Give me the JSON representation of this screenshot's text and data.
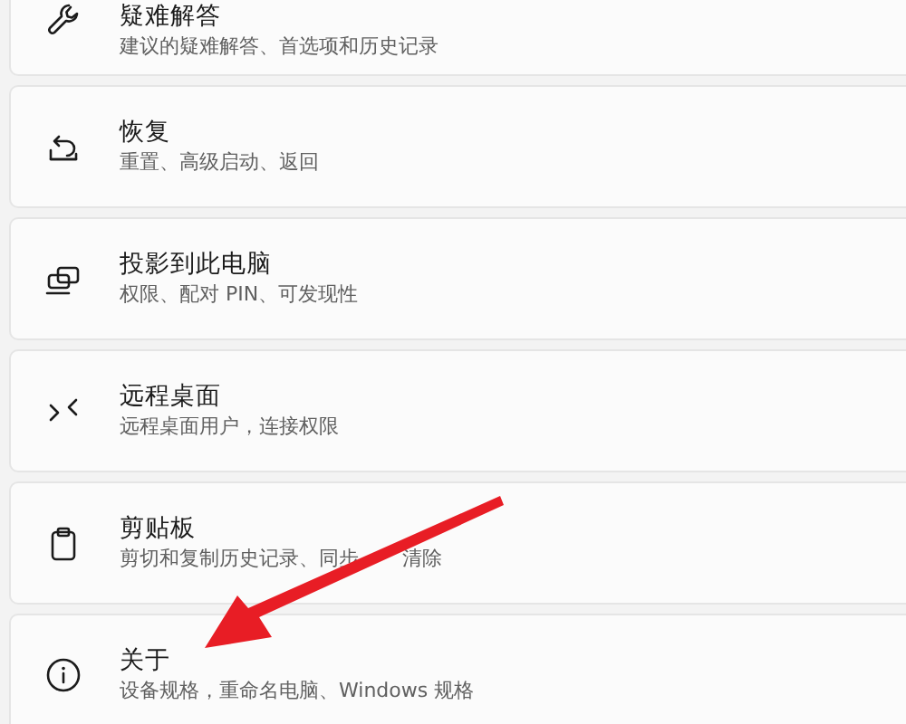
{
  "settings_items": [
    {
      "title": "疑难解答",
      "subtitle_parts": [
        "建议的疑难解答、首选项和历史记录"
      ]
    },
    {
      "title": "恢复",
      "subtitle_parts": [
        "重置、高级启动、返回"
      ]
    },
    {
      "title": "投影到此电脑",
      "subtitle_parts": [
        "权限、配对 PIN、可发现性"
      ]
    },
    {
      "title": "远程桌面",
      "subtitle_parts": [
        "远程桌面用户，连接权限"
      ]
    },
    {
      "title": "剪贴板",
      "subtitle_parts": [
        "剪切和复制历史记录、同步",
        "清除"
      ]
    },
    {
      "title": "关于",
      "subtitle_parts": [
        "设备规格，重命名电脑、Windows 规格"
      ]
    }
  ]
}
